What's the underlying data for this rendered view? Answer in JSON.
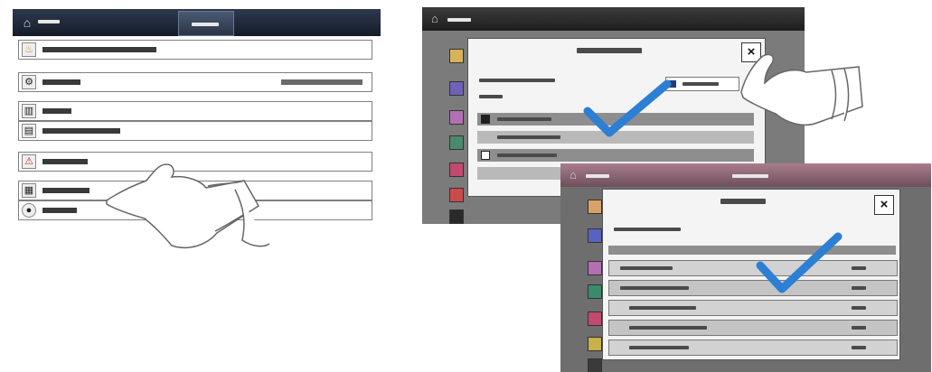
{
  "colors": {
    "checkmark": "#2d7fd3",
    "topbar": "#1f2736",
    "app_background": "#7b7b7b"
  },
  "panel1": {
    "rows": [
      {
        "icon": "flame-icon"
      },
      {
        "icon": "gear-icon"
      },
      {
        "icon": "tray-icon"
      },
      {
        "icon": "document-icon"
      },
      {
        "icon": "alert-icon"
      },
      {
        "icon": "printer-icon"
      },
      {
        "icon": "toner-icon"
      }
    ]
  },
  "panel2": {
    "close_label": "×"
  },
  "panel3": {
    "close_label": "×"
  }
}
